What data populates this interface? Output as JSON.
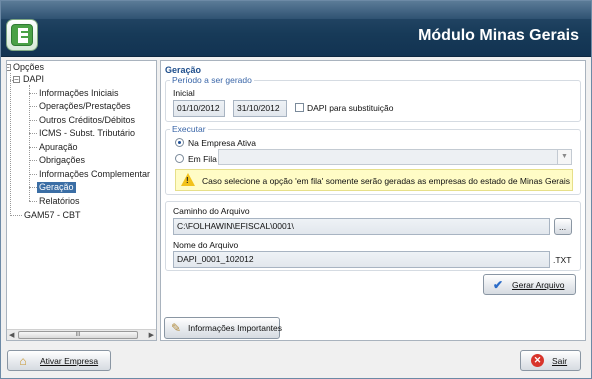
{
  "header": {
    "title": "Módulo Minas Gerais"
  },
  "tree": {
    "root": "Opções",
    "dapi": "DAPI",
    "items": [
      "Informações Iniciais",
      "Operações/Prestações",
      "Outros Créditos/Débitos",
      "ICMS - Subst. Tributário",
      "Apuração",
      "Obrigações",
      "Informações Complementar",
      "Geração",
      "Relatórios"
    ],
    "selected": "Geração",
    "gam": "GAM57 - CBT",
    "scroll_grip": "III"
  },
  "main": {
    "section_title": "Geração",
    "periodo": {
      "group_label": "Período a ser gerado",
      "inicial_label": "Inicial",
      "date_start": "01/10/2012",
      "date_end": "31/10/2012",
      "substituicao_label": "DAPI para substituição",
      "substituicao_checked": false
    },
    "executar": {
      "group_label": "Executar",
      "option_ativa": "Na Empresa Ativa",
      "option_fila": "Em Fila",
      "selected": "Na Empresa Ativa",
      "fila_value": "",
      "warning": "Caso selecione a opção 'em fila' somente serão geradas as empresas do estado de Minas Gerais"
    },
    "arquivo": {
      "caminho_label": "Caminho do Arquivo",
      "caminho_value": "C:\\FOLHAWIN\\EFISCAL\\0001\\",
      "browse_label": "...",
      "nome_label": "Nome do Arquivo",
      "nome_value": "DAPI_0001_102012",
      "extension": ".TXT"
    },
    "gerar_button": "Gerar Arquivo",
    "info_button": "Informações Importantes"
  },
  "footer": {
    "ativar_button": "Ativar Empresa",
    "sair_button": "Sair"
  },
  "colors": {
    "header_bg": "#173a58",
    "selection": "#3b6ea5",
    "warning_bg": "#fffcc6"
  }
}
